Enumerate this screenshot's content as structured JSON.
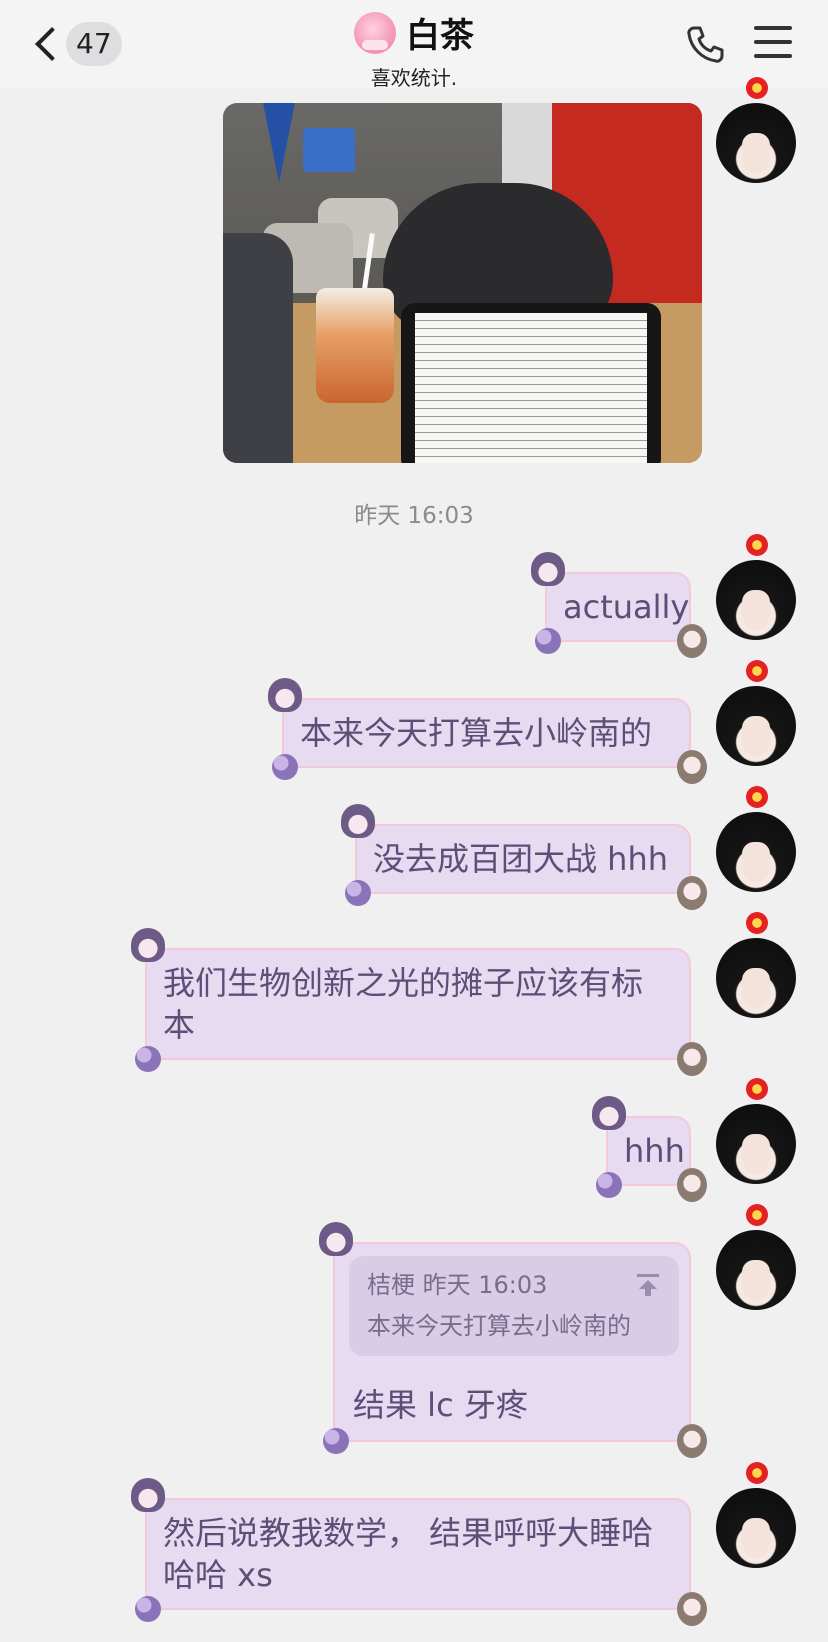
{
  "header": {
    "unread_count": "47",
    "contact_name": "白茶",
    "contact_status": "喜欢统计."
  },
  "chat": {
    "timestamp": "昨天 16:03",
    "messages": [
      {
        "text": "actually"
      },
      {
        "text": "本来今天打算去小岭南的"
      },
      {
        "text": "没去成百团大战 hhh"
      },
      {
        "text": "我们生物创新之光的摊子应该有标本"
      },
      {
        "text": "hhh"
      },
      {
        "quote": {
          "author": "桔梗",
          "time": "昨天 16:03",
          "text": "本来今天打算去小岭南的"
        },
        "text": "结果 lc 牙疼"
      },
      {
        "text": "然后说教我数学， 结果呼呼大睡哈哈哈 xs"
      }
    ]
  },
  "colors": {
    "bubble_bg": "#e6dbf1",
    "bubble_text": "#5b4f78",
    "bubble_border": "#f2c9da",
    "background": "#f0f0f1"
  },
  "icons": {
    "back": "chevron-left-icon",
    "call": "phone-icon",
    "menu": "hamburger-menu-icon",
    "quote_jump": "arrow-up-to-line-icon"
  }
}
